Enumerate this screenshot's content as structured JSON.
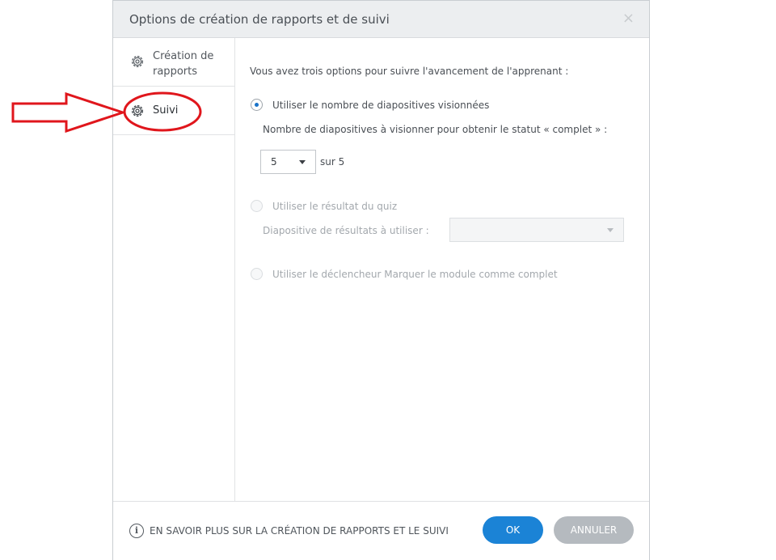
{
  "dialog": {
    "title": "Options de création de rapports et de suivi",
    "close_glyph": "×"
  },
  "sidebar": {
    "items": [
      {
        "label": "Création de rapports",
        "icon": "gear-icon",
        "selected": false
      },
      {
        "label": "Suivi",
        "icon": "gear-icon",
        "selected": true
      }
    ]
  },
  "content": {
    "intro": "Vous avez trois options pour suivre l'avancement de l'apprenant :",
    "option1": {
      "label": "Utiliser le nombre de diapositives visionnées",
      "checked": true,
      "sublabel": "Nombre de diapositives à visionner pour obtenir le statut « complet » :",
      "select_value": "5",
      "suffix": "sur 5"
    },
    "option2": {
      "label": "Utiliser le résultat du quiz",
      "checked": false,
      "disabled": true,
      "sublabel": "Diapositive de résultats à utiliser :",
      "select_value": ""
    },
    "option3": {
      "label": "Utiliser le déclencheur Marquer le module comme complet",
      "checked": false,
      "disabled": true
    }
  },
  "footer": {
    "info_glyph": "i",
    "learn_more": "EN SAVOIR PLUS SUR LA CRÉATION DE RAPPORTS ET LE SUIVI",
    "ok_label": "OK",
    "cancel_label": "ANNULER"
  },
  "colors": {
    "accent": "#1b83d6",
    "annotation": "#e0161c",
    "cancel": "#b5babf"
  }
}
